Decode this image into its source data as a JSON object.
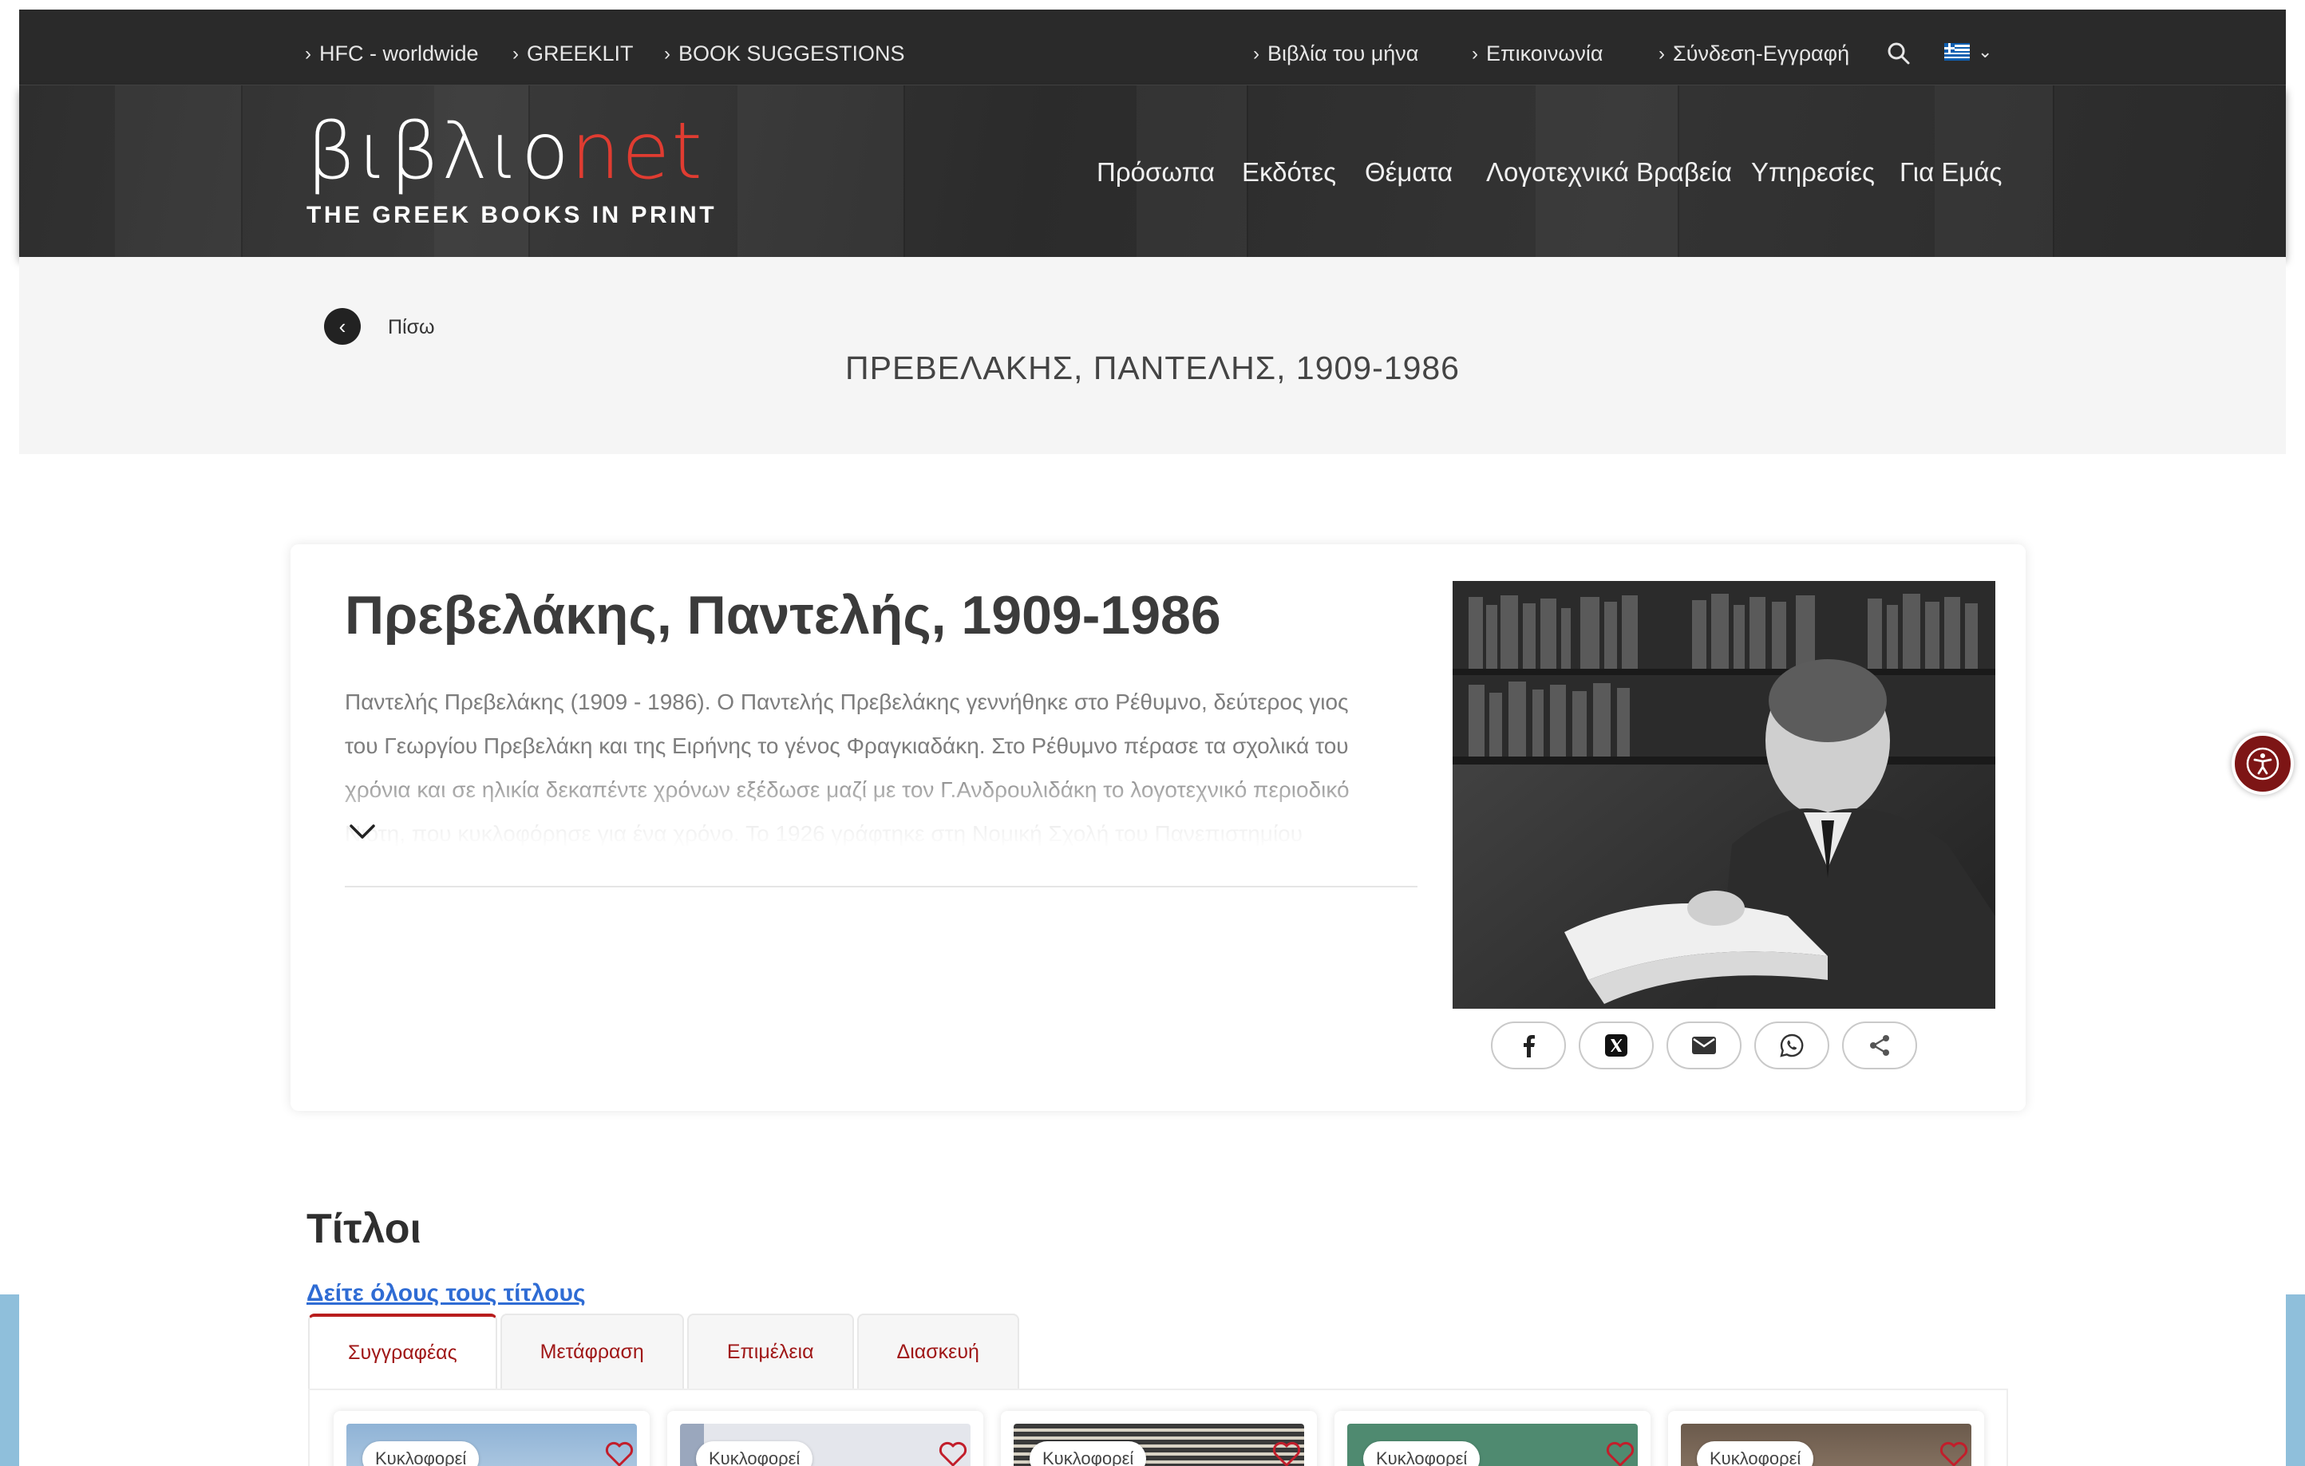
{
  "topbar": {
    "left_links": [
      "HFC - worldwide",
      "GREEKLIT",
      "BOOK SUGGESTIONS"
    ],
    "right_links": [
      "Βιβλία του μήνα",
      "Επικοινωνία",
      "Σύνδεση-Εγγραφή"
    ],
    "language_flag": "greek-flag-icon"
  },
  "header": {
    "logo_greek": "βιβλιο",
    "logo_net": "net",
    "logo_tagline": "THE GREEK BOOKS IN PRINT",
    "nav": [
      "Πρόσωπα",
      "Εκδότες",
      "Θέματα",
      "Λογοτεχνικά Βραβεία",
      "Υπηρεσίες",
      "Για Εμάς"
    ]
  },
  "band": {
    "back_label": "Πίσω",
    "title": "ΠΡΕΒΕΛΑΚΗΣ, ΠΑΝΤΕΛΗΣ, 1909-1986"
  },
  "person": {
    "name": "Πρεβελάκης, Παντελής, 1909-1986",
    "bio": "Παντελής Πρεβελάκης (1909 - 1986). Ο Παντελής Πρεβελάκης γεννήθηκε στο Ρέθυμνο, δεύτερος γιος του Γεωργίου Πρεβελάκη και της Ειρήνης το γένος Φραγκιαδάκη. Στο Ρέθυμνο πέρασε τα σχολικά του χρόνια και σε ηλικία δεκαπέντε χρόνων εξέδωσε μαζί με τον Γ.Ανδρουλιδάκη το λογοτεχνικό περιοδικό Νιότη, που κυκλοφόρησε για ένα χρόνο. Το 1926 γράφτηκε στη Νομική Σχολή του Πανεπιστημίου"
  },
  "share": [
    "facebook-icon",
    "x-icon",
    "email-icon",
    "whatsapp-icon",
    "share-icon"
  ],
  "titles": {
    "heading": "Τίτλοι",
    "all_link": "Δείτε όλους τους τίτλους",
    "tabs": [
      "Συγγραφέας",
      "Μετάφραση",
      "Επιμέλεια",
      "Διασκευή"
    ],
    "books": [
      {
        "badge": "Κυκλοφορεί"
      },
      {
        "badge": "Κυκλοφορεί"
      },
      {
        "badge": "Κυκλοφορεί"
      },
      {
        "badge": "Κυκλοφορεί"
      },
      {
        "badge": "Κυκλοφορεί"
      }
    ]
  },
  "colors": {
    "accent_red": "#b81d1d",
    "link_blue": "#2f6cd4",
    "logo_red": "#e03c31",
    "header_dark": "#2a2a2a"
  }
}
